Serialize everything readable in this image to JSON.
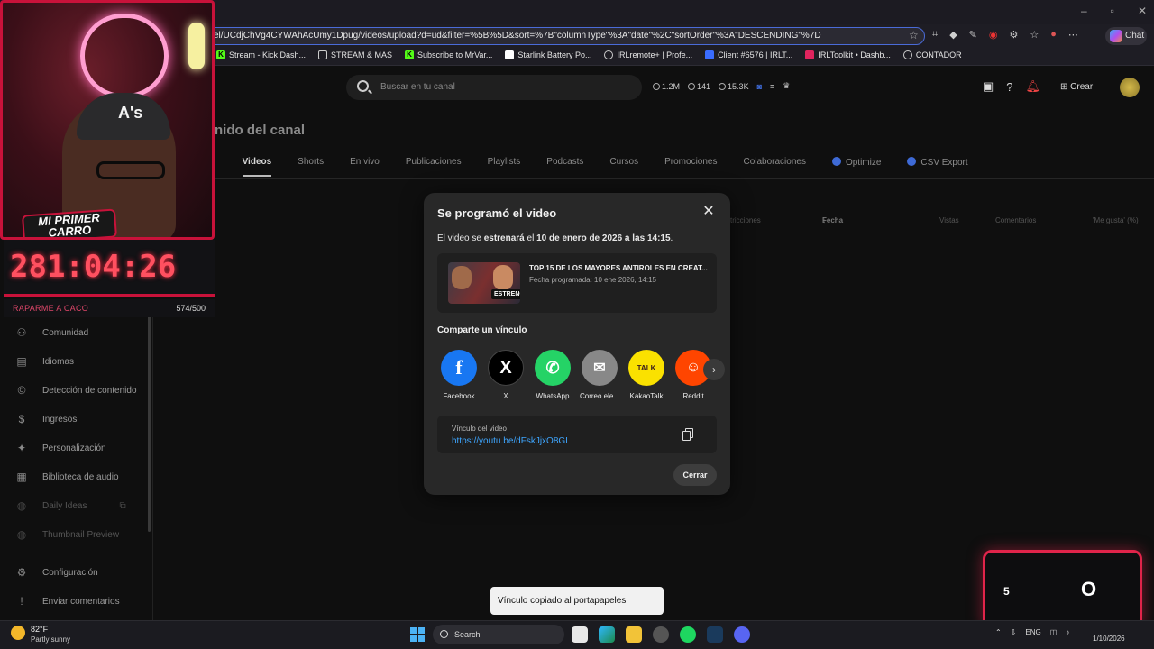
{
  "browser": {
    "url": "el/UCdjChVg4CYWAhAcUmy1Dpug/videos/upload?d=ud&filter=%5B%5D&sort=%7B\"columnType\"%3A\"date\"%2C\"sortOrder\"%3A\"DESCENDING\"%7D",
    "chat_label": "Chat",
    "bookmarks": [
      "Stream - Kick Dash...",
      "STREAM & MAS",
      "Subscribe to MrVar...",
      "Starlink Battery Po...",
      "IRLremote+ | Profe...",
      "Client #6576 | IRLT...",
      "IRLToolkit • Dashb...",
      "CONTADOR"
    ]
  },
  "studio": {
    "search_placeholder": "Buscar en tu canal",
    "stats": [
      "1.2M",
      "141",
      "15.3K"
    ],
    "create_label": "Crear",
    "page_title": "nido del canal",
    "tabs": [
      "n",
      "Videos",
      "Shorts",
      "En vivo",
      "Publicaciones",
      "Playlists",
      "Podcasts",
      "Cursos",
      "Promociones",
      "Colaboraciones",
      "Optimize",
      "CSV Export"
    ],
    "columns": [
      "tricciones",
      "Fecha",
      "Vistas",
      "Comentarios",
      "'Me gusta' (%)"
    ]
  },
  "sidebar": {
    "items": [
      {
        "label": "Comunidad",
        "icon": "community-icon"
      },
      {
        "label": "Idiomas",
        "icon": "subtitles-icon"
      },
      {
        "label": "Detección de contenido",
        "icon": "copyright-icon"
      },
      {
        "label": "Ingresos",
        "icon": "dollar-icon"
      },
      {
        "label": "Personalización",
        "icon": "magic-wand-icon"
      },
      {
        "label": "Biblioteca de audio",
        "icon": "audio-library-icon"
      },
      {
        "label": "Daily Ideas",
        "icon": "ideas-icon"
      },
      {
        "label": "Thumbnail Preview",
        "icon": "preview-icon"
      },
      {
        "label": "Configuración",
        "icon": "gear-icon"
      },
      {
        "label": "Enviar comentarios",
        "icon": "feedback-icon"
      }
    ]
  },
  "overlay": {
    "badge_line1": "MI PRIMER",
    "badge_line2": "CARRO",
    "timer": "281:04:26",
    "goal_label": "RAPARME A CACO",
    "goal_progress": "574/500",
    "counter_left": "5",
    "counter_right": "O"
  },
  "dialog": {
    "title": "Se programó el video",
    "msg_prefix": "El video se",
    "msg_verb": "estrenará",
    "msg_mid": "el",
    "msg_date": "10 de enero de 2026 a las 14:15",
    "video_title": "TOP 15 DE LOS MAYORES ANTIROLES EN CREAT...",
    "video_date": "Fecha programada: 10 ene 2026, 14:15",
    "thumb_badge": "ESTRENO",
    "share_label": "Comparte un vínculo",
    "share_targets": [
      "Facebook",
      "X",
      "WhatsApp",
      "Correo ele...",
      "KakaoTalk",
      "Reddit"
    ],
    "link_label": "Vínculo del video",
    "link_url": "https://youtu.be/dFskJjxO8GI",
    "close_label": "Cerrar"
  },
  "toast": "Vínculo copiado al portapapeles",
  "taskbar": {
    "temp": "82°F",
    "weather": "Partly sunny",
    "search": "Search",
    "lang": "ENG",
    "date": "1/10/2026"
  },
  "colors": {
    "accent_red": "#c8123a",
    "link_blue": "#3ea6ff",
    "facebook": "#1877f2",
    "whatsapp": "#25d366",
    "kakao": "#fae100",
    "reddit": "#ff4500"
  }
}
